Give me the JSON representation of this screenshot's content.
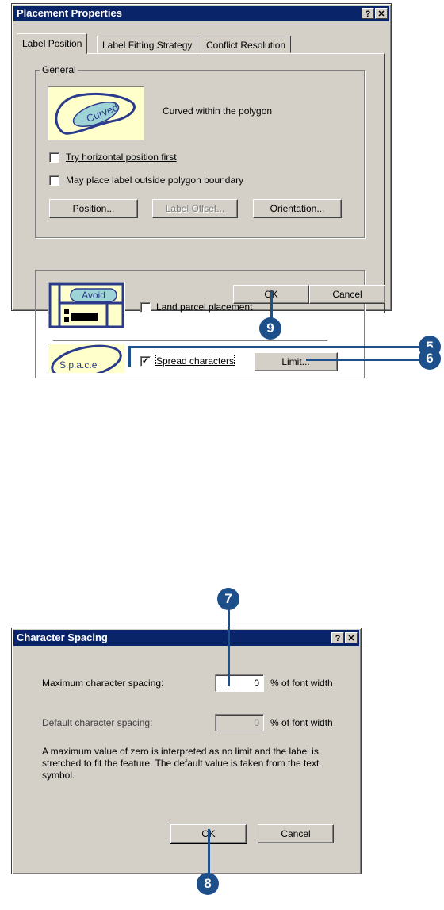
{
  "placement": {
    "title": "Placement Properties",
    "help_btn": "?",
    "close_btn": "✕",
    "tabs": [
      "Label Position",
      "Label Fitting Strategy",
      "Conflict Resolution"
    ],
    "general_legend": "General",
    "curved_word": "Curved",
    "curved_desc": "Curved within the polygon",
    "try_horizontal": "Try horizontal position first",
    "may_place": "May place label outside polygon boundary",
    "position_btn": "Position...",
    "label_offset_btn": "Label Offset...",
    "orientation_btn": "Orientation...",
    "avoid_word": "Avoid",
    "land_parcel": "Land parcel placement",
    "space_word": "S.p.a.c.e",
    "spread_chars": "Spread characters",
    "limit_btn": "Limit...",
    "ok_btn": "OK",
    "cancel_btn": "Cancel"
  },
  "spacing": {
    "title": "Character Spacing",
    "help_btn": "?",
    "close_btn": "✕",
    "max_label": "Maximum character spacing:",
    "max_value": "0",
    "max_unit": "% of font width",
    "default_label": "Default character spacing:",
    "default_value": "0",
    "default_unit": "% of font width",
    "note": "A maximum value of zero is interpreted as no limit and the label is stretched to fit the feature. The default value is taken from the text symbol.",
    "ok_btn": "OK",
    "cancel_btn": "Cancel"
  },
  "callouts": [
    "5",
    "6",
    "7",
    "8",
    "9"
  ],
  "colors": {
    "callout": "#1d4f8b",
    "titlebar": "#0a246a",
    "face": "#d4d0c8"
  }
}
